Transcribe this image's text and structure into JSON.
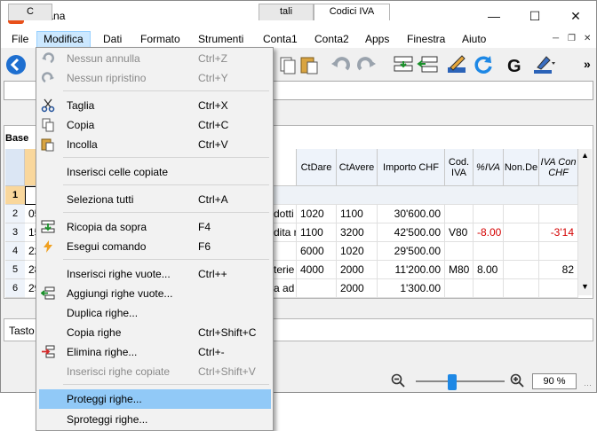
{
  "window": {
    "title": "Banana"
  },
  "menubar": [
    "File",
    "Modifica",
    "Dati",
    "Formato",
    "Strumenti",
    "Conta1",
    "Conta2",
    "Apps",
    "Finestra",
    "Aiuto"
  ],
  "tabs": [
    "C",
    "tali",
    "Codici IVA"
  ],
  "base_label": "Base",
  "columns": [
    "CtDare",
    "CtAvere",
    "Importo CHF",
    "Cod. IVA",
    "%IVA",
    "Non.De",
    "IVA Con CHF"
  ],
  "row_numbers": [
    "1",
    "2",
    "3",
    "4",
    "5",
    "6"
  ],
  "rows": [
    {
      "date": "",
      "desc": "",
      "ctdare": "",
      "ctavere": "",
      "importo": "",
      "cod": "",
      "piva": "",
      "iva": ""
    },
    {
      "date": "05",
      "desc": "dotti",
      "ctdare": "1020",
      "ctavere": "1100",
      "importo": "30'600.00",
      "cod": "",
      "piva": "",
      "iva": ""
    },
    {
      "date": "15",
      "desc": "dita r",
      "ctdare": "1100",
      "ctavere": "3200",
      "importo": "42'500.00",
      "cod": "V80",
      "piva": "-8.00",
      "iva": "-3'14"
    },
    {
      "date": "22",
      "desc": "",
      "ctdare": "6000",
      "ctavere": "1020",
      "importo": "29'500.00",
      "cod": "",
      "piva": "",
      "iva": ""
    },
    {
      "date": "28",
      "desc": "terie",
      "ctdare": "4000",
      "ctavere": "2000",
      "importo": "11'200.00",
      "cod": "M80",
      "piva": "8.00",
      "iva": "82"
    },
    {
      "date": "29",
      "desc": "a ad",
      "ctdare": "",
      "ctavere": "2000",
      "importo": "1'300.00",
      "cod": "",
      "piva": "",
      "iva": ""
    }
  ],
  "info_label": "Tasto",
  "zoom": {
    "value": "90 %"
  },
  "menu": {
    "items": [
      {
        "label": "Nessun annulla",
        "shortcut": "Ctrl+Z",
        "disabled": true,
        "icon": "undo-icon"
      },
      {
        "label": "Nessun ripristino",
        "shortcut": "Ctrl+Y",
        "disabled": true,
        "icon": "redo-icon"
      },
      {
        "label": "Taglia",
        "shortcut": "Ctrl+X",
        "icon": "scissors-icon"
      },
      {
        "label": "Copia",
        "shortcut": "Ctrl+C",
        "icon": "copy-icon"
      },
      {
        "label": "Incolla",
        "shortcut": "Ctrl+V",
        "icon": "paste-icon"
      },
      {
        "label": "Inserisci celle copiate",
        "shortcut": ""
      },
      {
        "label": "Seleziona tutti",
        "shortcut": "Ctrl+A"
      },
      {
        "label": "Ricopia da sopra",
        "shortcut": "F4",
        "icon": "copy-from-above-icon"
      },
      {
        "label": "Esegui comando",
        "shortcut": "F6",
        "icon": "lightning-icon"
      },
      {
        "label": "Inserisci righe vuote...",
        "shortcut": "Ctrl++"
      },
      {
        "label": "Aggiungi righe vuote...",
        "shortcut": "",
        "icon": "add-rows-icon"
      },
      {
        "label": "Duplica righe...",
        "shortcut": ""
      },
      {
        "label": "Copia righe",
        "shortcut": "Ctrl+Shift+C"
      },
      {
        "label": "Elimina righe...",
        "shortcut": "Ctrl+-",
        "icon": "delete-rows-icon"
      },
      {
        "label": "Inserisci righe copiate",
        "shortcut": "Ctrl+Shift+V",
        "disabled": true
      },
      {
        "label": "Proteggi righe...",
        "shortcut": "",
        "highlighted": true
      },
      {
        "label": "Sproteggi righe...",
        "shortcut": ""
      }
    ]
  },
  "colors": {
    "accent": "#1e88e5",
    "menu_highlight": "#91c9f7",
    "negative": "#d40000",
    "app_icon": "#e8501a"
  }
}
